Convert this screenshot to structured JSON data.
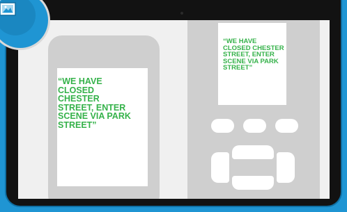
{
  "phone_message": "“WE HAVE CLOSED CHESTER STREET, ENTER SCENE VIA PARK STREET”",
  "device_message": "“WE HAVE CLOSED CHESTER STREET, ENTER SCENE VIA PARK STREET”",
  "badge": {
    "icon": "image-icon"
  },
  "colors": {
    "frame": "#1f95d3",
    "bezel": "#121212",
    "screen": "#f0f0f0",
    "device": "#cfcfcf",
    "message": "#35b24a"
  }
}
